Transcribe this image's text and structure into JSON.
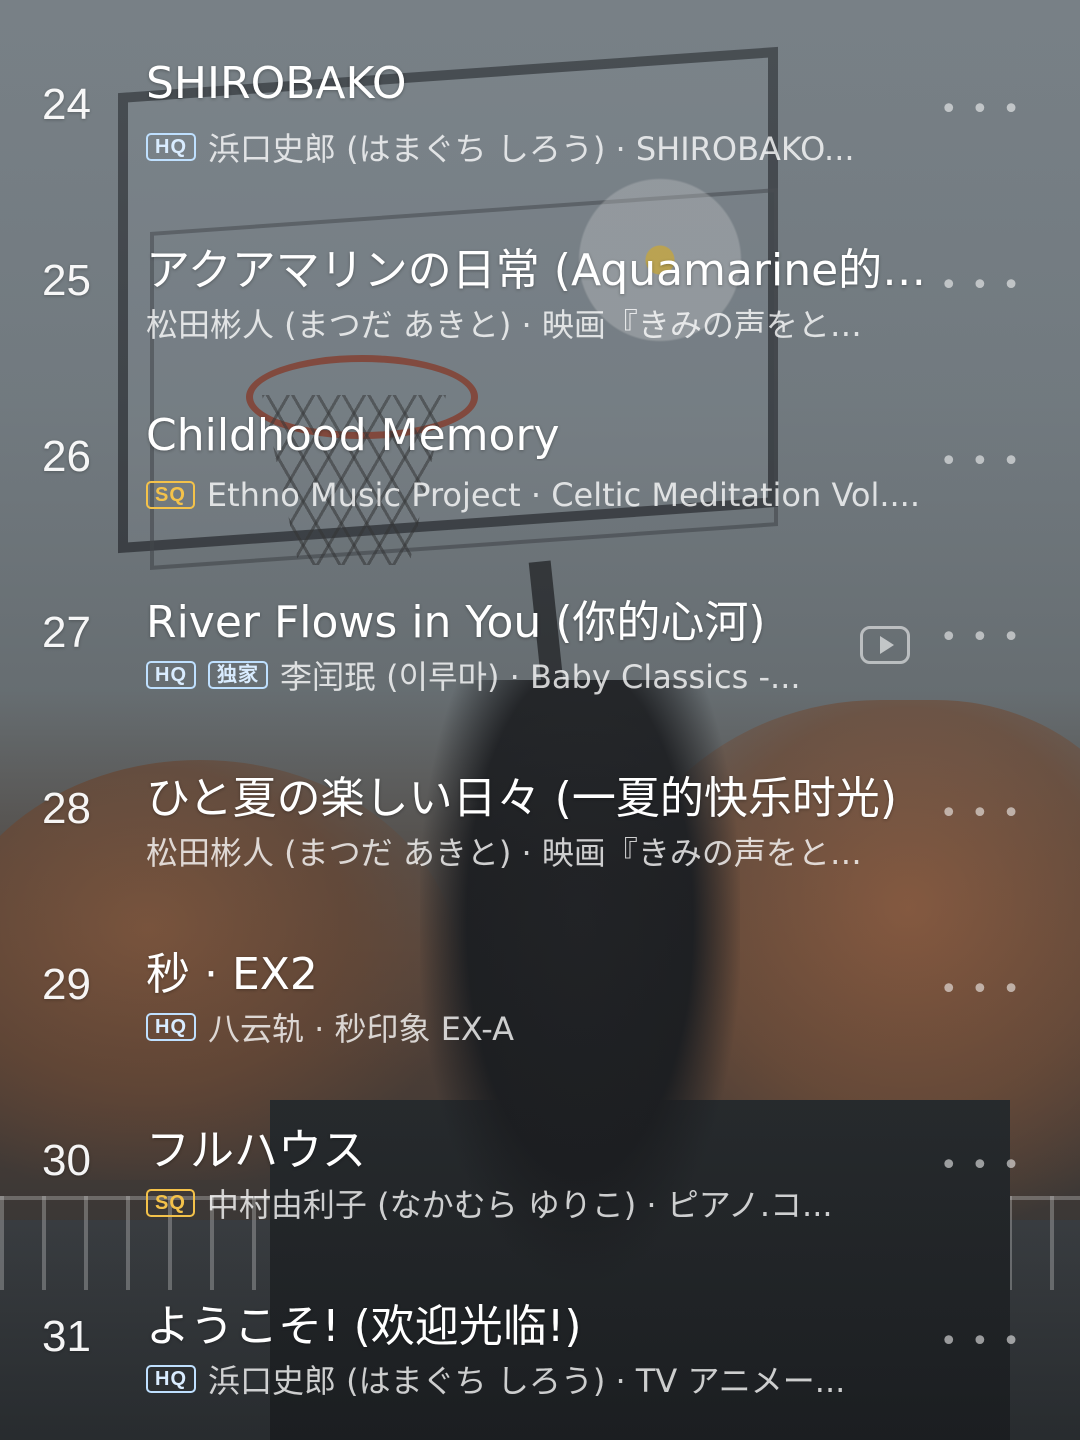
{
  "songs": [
    {
      "number": "24",
      "title": "SHIROBAKO",
      "badges": [
        "HQ"
      ],
      "meta": "浜口史郎 (はまぐち しろう) · SHIROBAKO...",
      "has_mv": false
    },
    {
      "number": "25",
      "title": "アクアマリンの日常 (Aquamarine的…",
      "badges": [],
      "meta": "松田彬人 (まつだ あきと) · 映画『きみの声をと…",
      "has_mv": false
    },
    {
      "number": "26",
      "title": "Childhood Memory",
      "badges": [
        "SQ"
      ],
      "meta": "Ethno Music Project · Celtic Meditation Vol....",
      "has_mv": false
    },
    {
      "number": "27",
      "title": "River Flows in You (你的心河)",
      "badges": [
        "HQ",
        "独家"
      ],
      "meta": "李闰珉 (이루마) · Baby Classics -...",
      "has_mv": true
    },
    {
      "number": "28",
      "title": "ひと夏の楽しい日々 (一夏的快乐时光)",
      "badges": [],
      "meta": "松田彬人 (まつだ あきと) · 映画『きみの声をと…",
      "has_mv": false
    },
    {
      "number": "29",
      "title": "秒 · EX2",
      "badges": [
        "HQ"
      ],
      "meta": "八云轨 · 秒印象 EX-A",
      "has_mv": false
    },
    {
      "number": "30",
      "title": "フルハウス",
      "badges": [
        "SQ"
      ],
      "meta": "中村由利子 (なかむら ゆりこ) · ピアノ.コ...",
      "has_mv": false
    },
    {
      "number": "31",
      "title": "ようこそ! (欢迎光临!)",
      "badges": [
        "HQ"
      ],
      "meta": "浜口史郎 (はまぐち しろう) · TV アニメー...",
      "has_mv": false
    }
  ],
  "icons": {
    "more": "more-dots-icon",
    "mv": "play-video-icon"
  },
  "colors": {
    "hq_badge": "#bfe0ff",
    "sq_badge": "#f4c24a"
  }
}
